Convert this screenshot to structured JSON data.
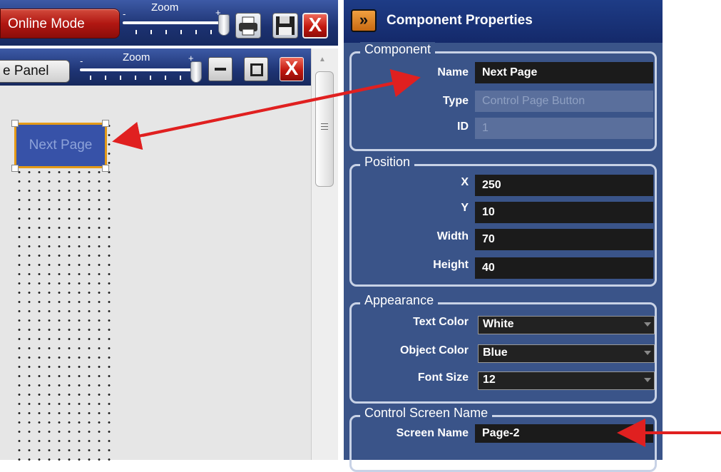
{
  "toolbar": {
    "online_mode_label": "Online Mode",
    "zoom_label": "Zoom",
    "zoom_minus": "-",
    "zoom_plus": "+"
  },
  "panel": {
    "panel_label": "e Panel",
    "zoom_label": "Zoom",
    "zoom_minus": "-",
    "zoom_plus": "+"
  },
  "canvas": {
    "button_label": "Next Page"
  },
  "properties": {
    "title": "Component Properties",
    "collapse_glyph": "»",
    "component": {
      "title": "Component",
      "name_label": "Name",
      "name_value": "Next Page",
      "type_label": "Type",
      "type_value": "Control Page Button",
      "id_label": "ID",
      "id_value": "1"
    },
    "position": {
      "title": "Position",
      "x_label": "X",
      "x_value": "250",
      "y_label": "Y",
      "y_value": "10",
      "width_label": "Width",
      "width_value": "70",
      "height_label": "Height",
      "height_value": "40"
    },
    "appearance": {
      "title": "Appearance",
      "text_color_label": "Text Color",
      "text_color_value": "White",
      "object_color_label": "Object Color",
      "object_color_value": "Blue",
      "font_size_label": "Font Size",
      "font_size_value": "12"
    },
    "control_screen": {
      "title": "Control Screen Name",
      "screen_name_label": "Screen Name",
      "screen_name_value": "Page-2"
    }
  },
  "colors": {
    "toolbar_blue": "#1c3170",
    "panel_bg": "#3a5489",
    "selection_orange": "#e49a17",
    "button_blue": "#3752a8",
    "annotation_red": "#e02020"
  },
  "icons": [
    "printer-icon",
    "save-icon",
    "close-icon",
    "minimize-icon",
    "maximize-icon",
    "collapse-icon",
    "scroll-up-icon"
  ]
}
